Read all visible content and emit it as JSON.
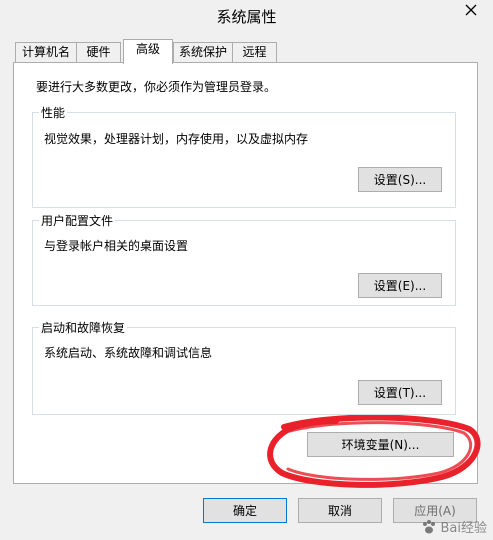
{
  "window": {
    "title": "系统属性"
  },
  "tabs": [
    {
      "label": "计算机名"
    },
    {
      "label": "硬件"
    },
    {
      "label": "高级"
    },
    {
      "label": "系统保护"
    },
    {
      "label": "远程"
    }
  ],
  "advanced": {
    "admin_notice": "要进行大多数更改，你必须作为管理员登录。",
    "performance": {
      "legend": "性能",
      "desc": "视觉效果，处理器计划，内存使用，以及虚拟内存",
      "button": "设置(S)..."
    },
    "user_profiles": {
      "legend": "用户配置文件",
      "desc": "与登录帐户相关的桌面设置",
      "button": "设置(E)..."
    },
    "startup_recovery": {
      "legend": "启动和故障恢复",
      "desc": "系统启动、系统故障和调试信息",
      "button": "设置(T)..."
    },
    "env_button": "环境变量(N)..."
  },
  "footer": {
    "ok": "确定",
    "cancel": "取消",
    "apply": "应用(A)"
  },
  "watermark": "Bai经验",
  "colors": {
    "highlight_circle": "#e8212a"
  }
}
